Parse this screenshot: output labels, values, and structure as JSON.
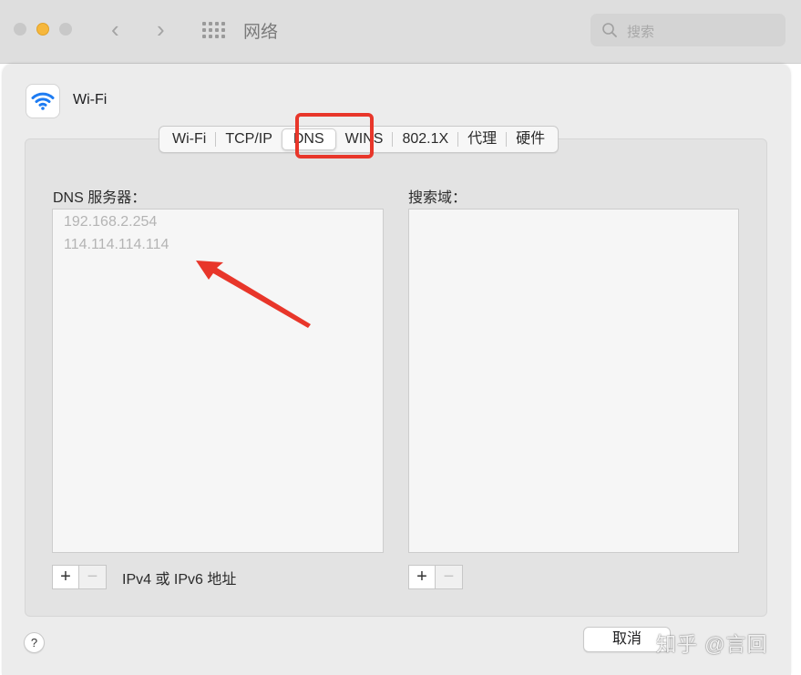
{
  "window": {
    "title": "网络",
    "search_placeholder": "搜索"
  },
  "interface": {
    "name": "Wi-Fi"
  },
  "tabs": [
    {
      "label": "Wi-Fi"
    },
    {
      "label": "TCP/IP"
    },
    {
      "label": "DNS",
      "selected": true
    },
    {
      "label": "WINS"
    },
    {
      "label": "802.1X"
    },
    {
      "label": "代理"
    },
    {
      "label": "硬件"
    }
  ],
  "dns": {
    "label": "DNS 服务器：",
    "servers": [
      "192.168.2.254",
      "114.114.114.114"
    ],
    "hint": "IPv4 或 IPv6 地址"
  },
  "search_domains": {
    "label": "搜索域：",
    "items": []
  },
  "controls": {
    "add": "+",
    "remove": "−",
    "help": "?",
    "cancel": "取消"
  },
  "watermark": "知乎 @言回",
  "colors": {
    "highlight": "#e8362a",
    "wifi_blue": "#1e7cf2"
  }
}
